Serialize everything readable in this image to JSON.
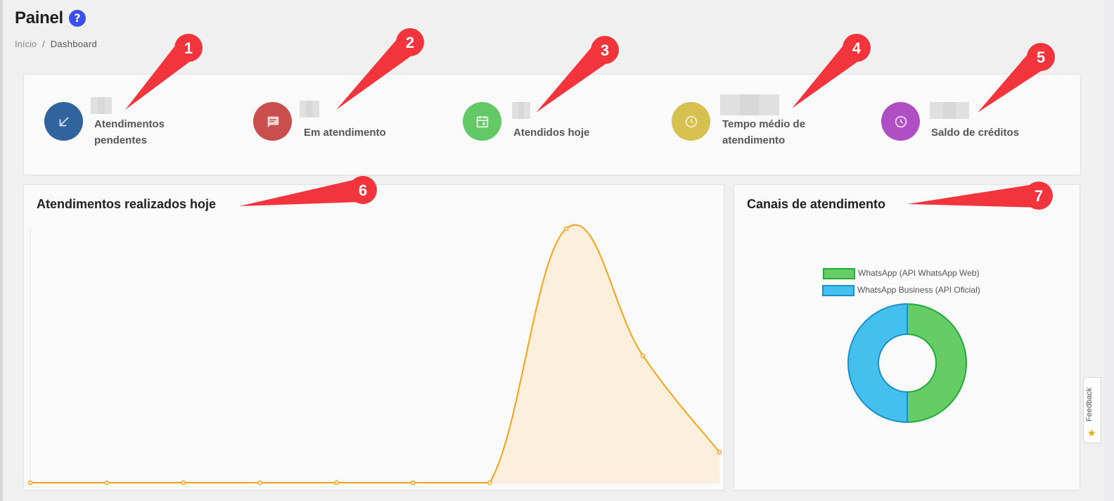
{
  "header": {
    "title": "Painel",
    "help_icon": "help-circle-icon",
    "breadcrumb": {
      "home": "Início",
      "separator": "/",
      "current": "Dashboard"
    }
  },
  "stats": [
    {
      "label_lines": [
        "Atendimentos",
        "pendentes"
      ],
      "icon": "arrow-down-left-icon",
      "color": "#31639c"
    },
    {
      "label_lines": [
        "Em atendimento"
      ],
      "icon": "chat-bubble-icon",
      "color": "#c94e4e"
    },
    {
      "label_lines": [
        "Atendidos hoje"
      ],
      "icon": "calendar-icon",
      "color": "#63c866"
    },
    {
      "label_lines": [
        "Tempo médio de",
        "atendimento"
      ],
      "icon": "clock-icon",
      "color": "#d6c04f"
    },
    {
      "label_lines": [
        "Saldo de créditos"
      ],
      "icon": "clock-icon",
      "color": "#b04fc4"
    }
  ],
  "attendance_chart": {
    "title": "Atendimentos realizados hoje",
    "chart_data": {
      "type": "area",
      "x": [
        0,
        1,
        2,
        3,
        4,
        5,
        6,
        7,
        8,
        9
      ],
      "values": [
        0,
        0,
        0,
        0,
        0,
        0,
        0,
        100,
        50,
        12
      ],
      "ylim": [
        0,
        100
      ],
      "grid": false,
      "line_color": "#f7a21b",
      "fill_color": "#fcefdc"
    }
  },
  "channels_chart": {
    "title": "Canais de atendimento",
    "chart_data": {
      "type": "pie",
      "donut": true,
      "labels": [
        "WhatsApp (API WhatsApp Web)",
        "WhatsApp Business (API Oficial)"
      ],
      "values": [
        50,
        50
      ],
      "colors": [
        "#66cc66",
        "#45c0ee"
      ],
      "border_colors": [
        "#22aa3a",
        "#1a90c8"
      ],
      "legend_position": "top"
    }
  },
  "callouts": [
    "1",
    "2",
    "3",
    "4",
    "5",
    "6",
    "7"
  ],
  "callout_color": "#f2353d",
  "feedback": {
    "label": "Feedback",
    "icon": "star-icon"
  }
}
